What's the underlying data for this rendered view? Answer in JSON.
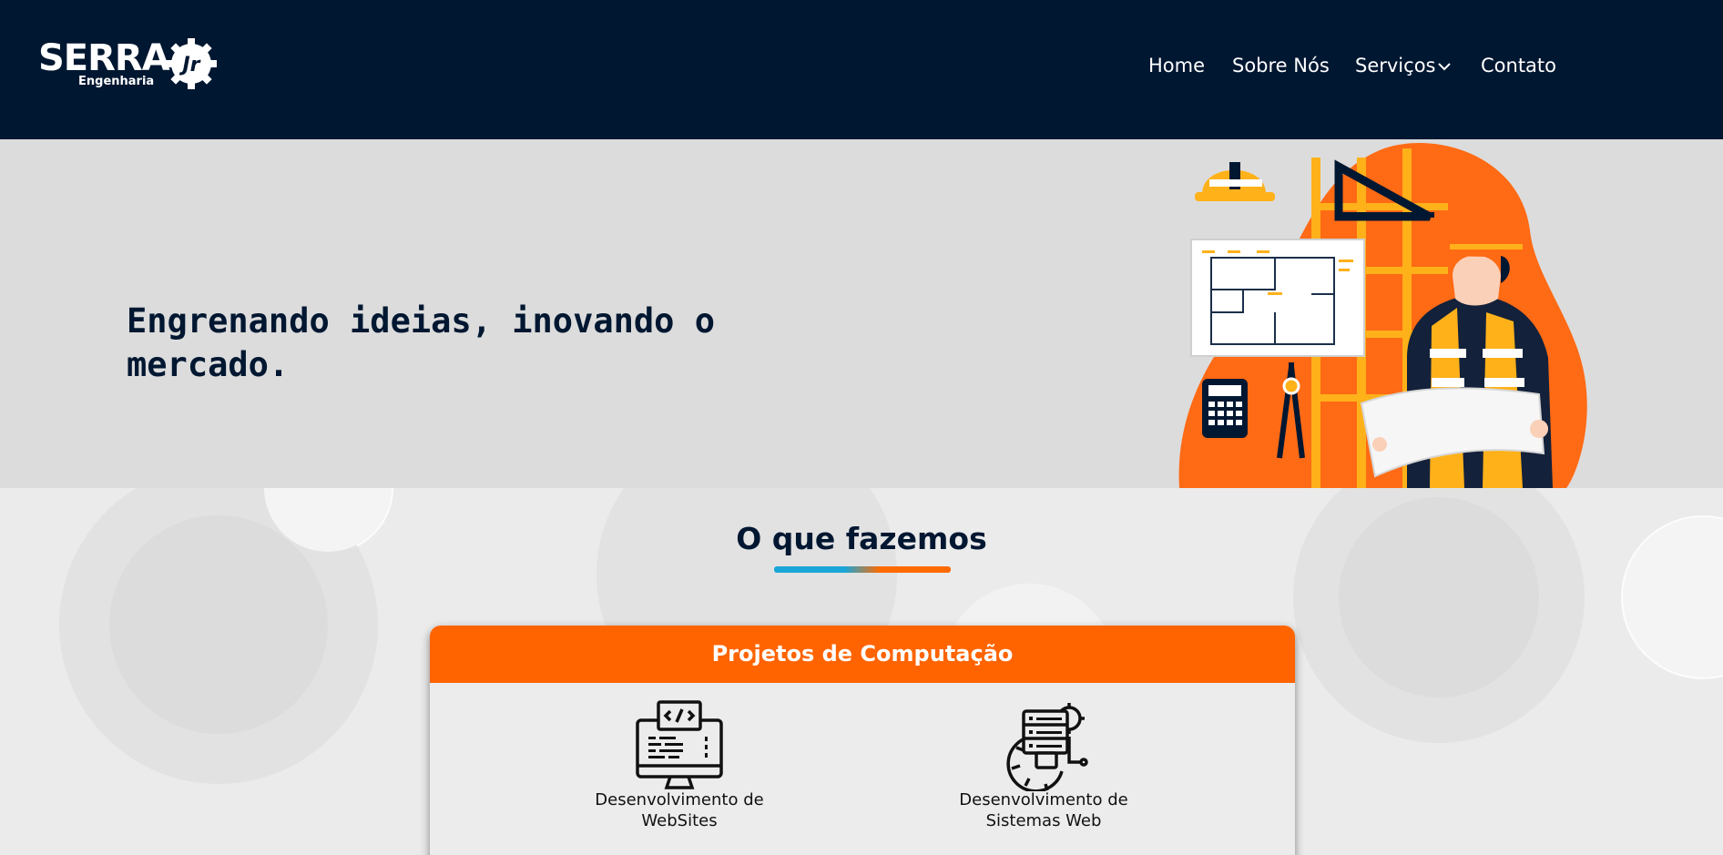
{
  "header": {
    "logo": {
      "word": "SERRA",
      "sub": "Engenharia",
      "badge": "Jr"
    },
    "nav": [
      {
        "label": "Home"
      },
      {
        "label": "Sobre Nós"
      },
      {
        "label": "Serviços"
      },
      {
        "label": "Contato"
      }
    ]
  },
  "hero": {
    "title": "Engrenando ideias, inovando o mercado."
  },
  "services": {
    "section_title": "O que fazemos",
    "card_title": "Projetos de Computação",
    "items": [
      {
        "label": "Desenvolvimento de WebSites",
        "icon": "monitor-code-icon"
      },
      {
        "label": "Desenvolvimento de Sistemas Web",
        "icon": "web-system-gear-icon"
      }
    ]
  },
  "colors": {
    "navy": "#001731",
    "orange": "#ff6400",
    "hero_bg": "#dcdcdc",
    "accent_blue": "#1aa6d8"
  }
}
